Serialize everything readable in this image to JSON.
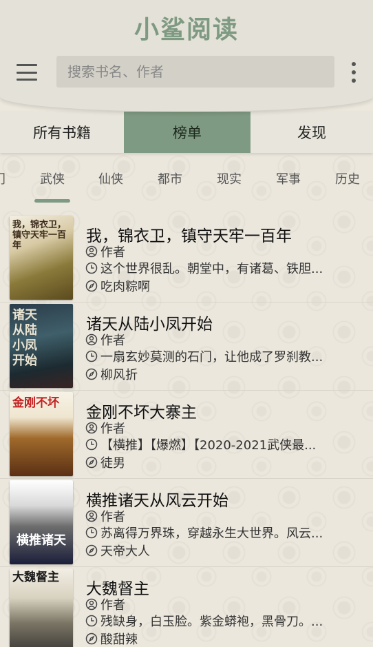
{
  "header": {
    "app_title": "小鲨阅读",
    "search_placeholder": "搜索书名、作者"
  },
  "tabs": [
    {
      "label": "所有书籍",
      "active": false
    },
    {
      "label": "榜单",
      "active": true
    },
    {
      "label": "发现",
      "active": false
    }
  ],
  "categories": {
    "items": [
      "门",
      "武侠",
      "仙侠",
      "都市",
      "现实",
      "军事",
      "历史"
    ],
    "selected": "武侠"
  },
  "books": [
    {
      "title": "我，锦衣卫，镇守天牢一百年",
      "author_label": "作者",
      "summary": "这个世界很乱。朝堂中，有诸葛、铁胆...",
      "author": "吃肉粽啊",
      "cover_text": "我，锦衣卫，镇守天牢一百年"
    },
    {
      "title": "诸天从陆小凤开始",
      "author_label": "作者",
      "summary": "一扇玄妙莫测的石门，让他成了罗刹教...",
      "author": "柳风折",
      "cover_text": "诸天 从陆小凤开始"
    },
    {
      "title": "金刚不坏大寨主",
      "author_label": "作者",
      "summary": "【横推】【爆燃】【2020-2021武侠最...",
      "author": "徒男",
      "cover_text": "金刚不坏"
    },
    {
      "title": "横推诸天从风云开始",
      "author_label": "作者",
      "summary": "苏离得万界珠，穿越永生大世界。风云...",
      "author": "天帝大人",
      "cover_text": "横推诸天"
    },
    {
      "title": "大魏督主",
      "author_label": "作者",
      "summary": "残缺身，白玉脸。紫金蟒袍，黑骨刀。...",
      "author": "酸甜辣",
      "cover_text": "大魏督主"
    }
  ],
  "colors": {
    "accent": "#7f9a82",
    "header_bg": "#e4e2d8",
    "page_bg": "#ebe7dd"
  },
  "icons": {
    "author": "person-circle-icon",
    "summary": "clock-icon",
    "source": "compass-icon"
  }
}
